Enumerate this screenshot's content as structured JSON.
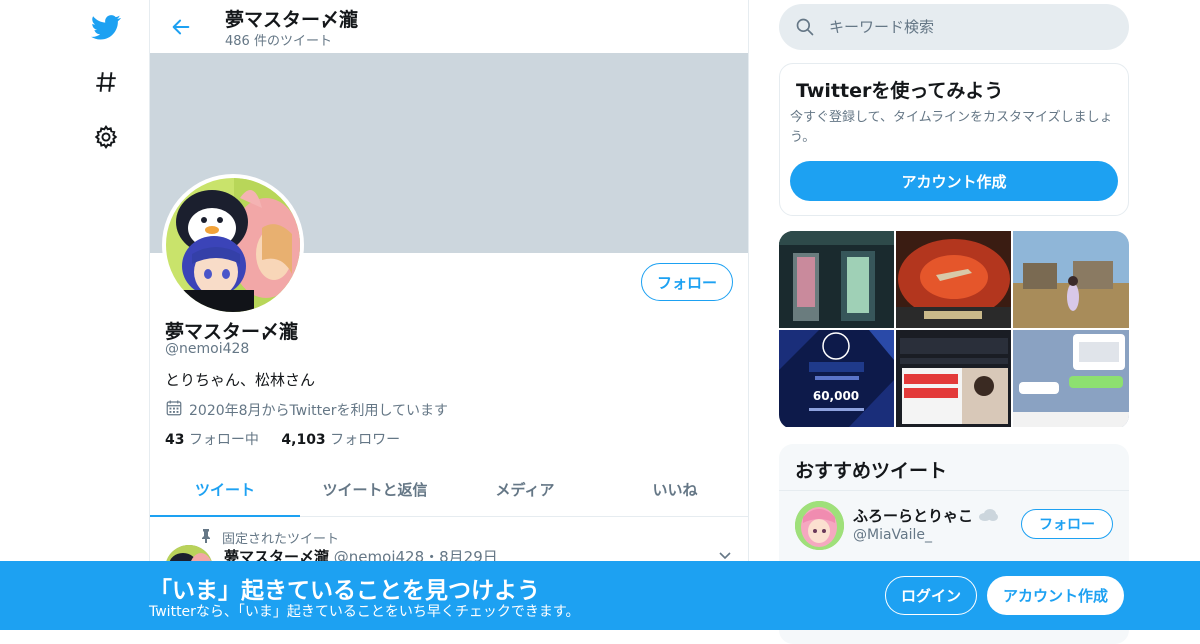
{
  "nav": {
    "items": [
      {
        "icon": "twitter-bird-icon"
      },
      {
        "icon": "hashtag-icon"
      },
      {
        "icon": "gear-icon"
      }
    ]
  },
  "header": {
    "title": "夢マスター〆瀧",
    "tweet_count": "486 件のツイート"
  },
  "profile": {
    "name": "夢マスター〆瀧",
    "handle": "@nemoi428",
    "bio": "とりちゃん、松林さん",
    "joined": "2020年8月からTwitterを利用しています",
    "following_count": "43",
    "following_label": "フォロー中",
    "followers_count": "4,103",
    "followers_label": "フォロワー",
    "follow_button": "フォロー"
  },
  "tabs": [
    {
      "label": "ツイート",
      "active": true
    },
    {
      "label": "ツイートと返信",
      "active": false
    },
    {
      "label": "メディア",
      "active": false
    },
    {
      "label": "いいね",
      "active": false
    }
  ],
  "pinned_tweet": {
    "label": "固定されたツイート",
    "author": "夢マスター〆瀧",
    "meta": "@nemoi428・8月29日"
  },
  "search": {
    "placeholder": "キーワード検索"
  },
  "signup_card": {
    "title": "Twitterを使ってみよう",
    "text": "今すぐ登録して、タイムラインをカスタマイズしましょう。",
    "button": "アカウント作成"
  },
  "media_thumbs": {
    "caption_1": "60,000"
  },
  "recommended": {
    "title": "おすすめツイート",
    "user": {
      "name": "ふろーらとりゃこ",
      "handle": "@MiaVaile_",
      "follow_button": "フォロー"
    }
  },
  "bottom_bar": {
    "title": "「いま」起きていることを見つけよう",
    "subtitle": "Twitterなら、「いま」起きていることをいち早くチェックできます。",
    "login": "ログイン",
    "signup": "アカウント作成"
  },
  "colors": {
    "accent": "#1da1f2",
    "banner": "#ccd6dd",
    "secondary_text": "#657786"
  }
}
